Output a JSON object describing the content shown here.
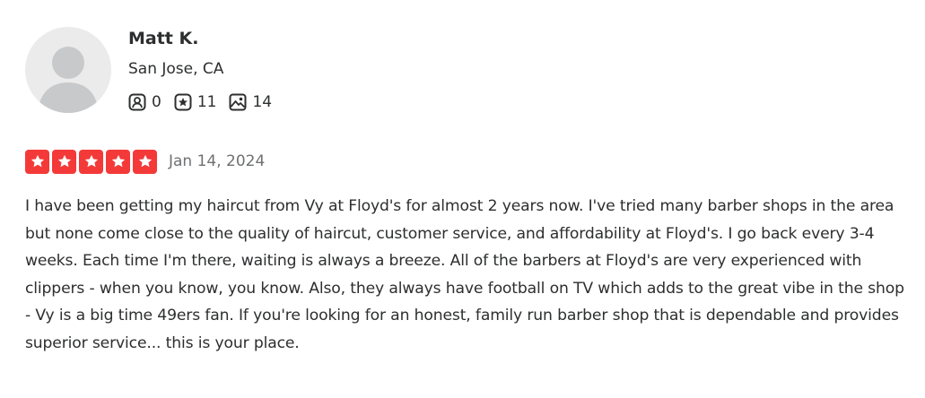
{
  "user": {
    "name": "Matt K.",
    "location": "San Jose, CA",
    "stats": {
      "friends": "0",
      "reviews": "11",
      "photos": "14"
    }
  },
  "review": {
    "rating": 5,
    "max_rating": 5,
    "date": "Jan 14, 2024",
    "text": "I have been getting my haircut from Vy at Floyd's for almost 2 years now. I've tried many barber shops in the area but none come close to the quality of haircut, customer service, and affordability at Floyd's. I go back every 3-4 weeks. Each time I'm there, waiting is always a breeze. All of the barbers at Floyd's are very experienced with clippers - when you know, you know. Also, they always have football on TV which adds to the great vibe in the shop - Vy is a big time 49ers fan. If you're looking for an honest, family run barber shop that is dependable and provides superior service... this is your place."
  },
  "colors": {
    "star_red": "#f43939",
    "text_primary": "#2d2e2f",
    "text_secondary": "#6e7072",
    "avatar_bg": "#ebebeb"
  },
  "icons": {
    "avatar": "user-silhouette-icon",
    "friends": "friends-icon",
    "reviews": "star-badge-icon",
    "photos": "photo-icon",
    "star": "star-icon"
  }
}
